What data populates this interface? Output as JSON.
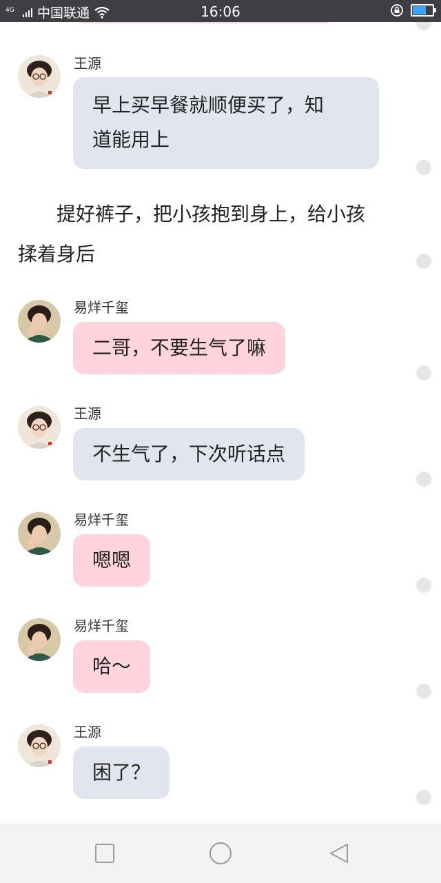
{
  "status_bar": {
    "network": "4G",
    "carrier": "中国联通",
    "time": "16:06"
  },
  "messages": [
    {
      "type": "chat",
      "sender": "王源",
      "text": "早上买早餐就顺便买了，知道能用上",
      "line1": "早上买早餐就顺便买了，知",
      "line2": "道能用上",
      "style": "gray"
    },
    {
      "type": "narration",
      "line1": "　　提好裤子，把小孩抱到身上，给小孩",
      "line2": "揉着身后"
    },
    {
      "type": "chat",
      "sender": "易烊千玺",
      "text": "二哥，不要生气了嘛",
      "style": "pink"
    },
    {
      "type": "chat",
      "sender": "王源",
      "text": "不生气了，下次听话点",
      "style": "gray"
    },
    {
      "type": "chat",
      "sender": "易烊千玺",
      "text": "嗯嗯",
      "style": "pink"
    },
    {
      "type": "chat",
      "sender": "易烊千玺",
      "text": "哈～",
      "style": "pink"
    },
    {
      "type": "chat",
      "sender": "王源",
      "text": "困了？",
      "style": "gray"
    }
  ],
  "nav": {
    "recent": "square-icon",
    "home": "circle-icon",
    "back": "triangle-back-icon"
  },
  "colors": {
    "bubble_gray": "#e1e6ee",
    "bubble_pink": "#ffd4dd",
    "status_bar": "#3f3f43",
    "battery": "#3aa3ff"
  }
}
